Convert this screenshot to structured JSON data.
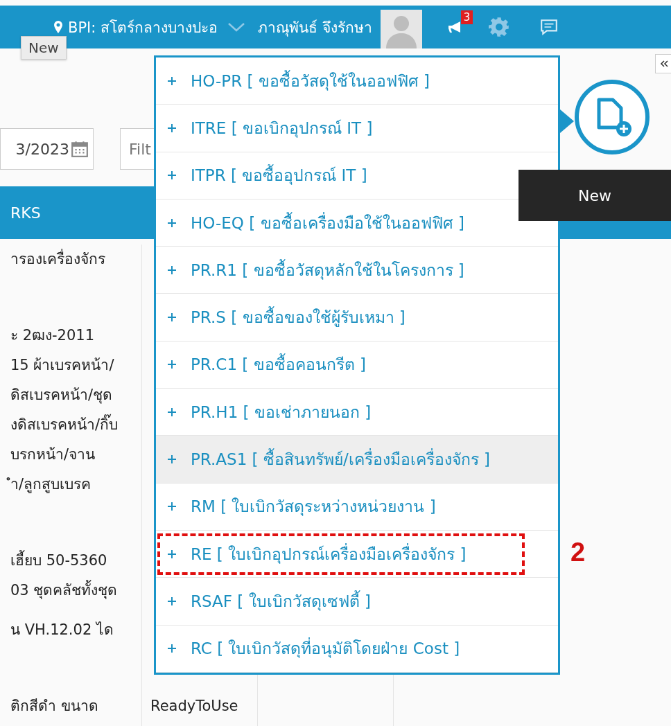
{
  "topbar": {
    "branch": "BPI: สโตร์กลางบางปะอ",
    "user": "ภาณุพันธ์ จึงรักษา",
    "notification_count": "3"
  },
  "top_tooltip": "New",
  "filters": {
    "date": "3/2023",
    "filter_placeholder": "Filt"
  },
  "table": {
    "columns": [
      "RKS"
    ],
    "rows": [
      {
        "remarks": [
          "ารองเครื่องจักร"
        ]
      },
      {
        "remarks": [
          "ะ 2ฒง-2011",
          "15 ผ้าเบรคหน้า/",
          "ดิสเบรคหน้า/ชุด",
          "งดิสเบรคหน้า/กิ๊บ",
          "บรกหน้า/จาน",
          "ำ/ลูกสูบเบรค"
        ]
      },
      {
        "remarks": [
          "เฮี้ยบ 50-5360",
          "03 ชุดคลัชทั้งชุด"
        ]
      },
      {
        "remarks": [
          "น VH.12.02 ได"
        ]
      },
      {
        "remarks": [
          "ติกสีดำ ขนาด"
        ],
        "status": "ReadyToUse"
      }
    ]
  },
  "new_menu": [
    {
      "label": "HO-PR [ ขอซื้อวัสดุใช้ในออฟฟิศ ]",
      "selected": false,
      "highlighted": false
    },
    {
      "label": "ITRE [ ขอเบิกอุปกรณ์ IT ]",
      "selected": false,
      "highlighted": false
    },
    {
      "label": "ITPR [ ขอซื้ออุปกรณ์ IT ]",
      "selected": false,
      "highlighted": false
    },
    {
      "label": "HO-EQ [ ขอซื้อเครื่องมือใช้ในออฟฟิศ ]",
      "selected": false,
      "highlighted": false
    },
    {
      "label": "PR.R1 [ ขอซื้อวัสดุหลักใช้ในโครงการ ]",
      "selected": false,
      "highlighted": false
    },
    {
      "label": "PR.S [ ขอซื้อของใช้ผู้รับเหมา ]",
      "selected": false,
      "highlighted": false
    },
    {
      "label": "PR.C1 [ ขอซื้อคอนกรีต ]",
      "selected": false,
      "highlighted": false
    },
    {
      "label": "PR.H1 [ ขอเช่าภายนอก ]",
      "selected": false,
      "highlighted": false
    },
    {
      "label": "PR.AS1 [ ซื้อสินทรัพย์/เครื่องมือเครื่องจักร ]",
      "selected": true,
      "highlighted": false
    },
    {
      "label": "RM [ ใบเบิกวัสดุระหว่างหน่วยงาน ]",
      "selected": false,
      "highlighted": false
    },
    {
      "label": "RE [ ใบเบิกอุปกรณ์เครื่องมือเครื่องจักร ]",
      "selected": false,
      "highlighted": true
    },
    {
      "label": "RSAF [ ใบเบิกวัสดุเซฟตี้ ]",
      "selected": false,
      "highlighted": false
    },
    {
      "label": "RC [ ใบเบิกวัสดุที่อนุมัติโดยฝ่าย Cost ]",
      "selected": false,
      "highlighted": false
    }
  ],
  "annotation_label": "2",
  "new_button_tooltip": "New"
}
